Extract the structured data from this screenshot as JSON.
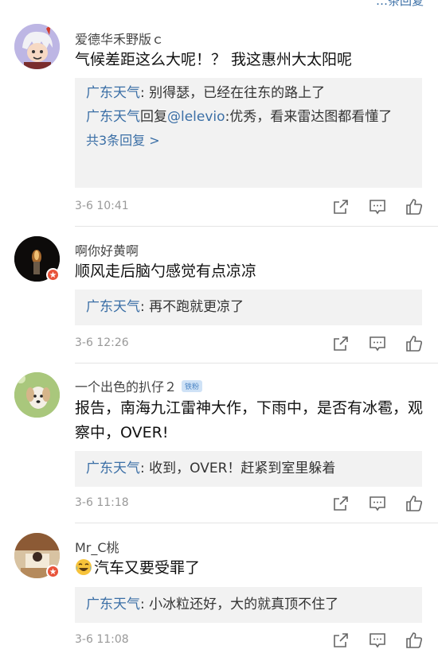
{
  "top_link": "…条回复",
  "comments": [
    {
      "user": "爱德华禾野版ｃ",
      "text": "气候差距这么大呢！？ 我这惠州大太阳呢",
      "replies": [
        {
          "name": "广东天气",
          "mid": "",
          "mention": "",
          "text": ": 别得瑟，已经在往东的路上了"
        },
        {
          "name": "广东天气",
          "mid": "回复",
          "mention": "@lelevio",
          "text": ":优秀，看来雷达图都看懂了"
        }
      ],
      "more": "共3条回复 >",
      "time": "3-6 10:41"
    },
    {
      "user": "啊你好黄啊",
      "text": "顺风走后脑勺感觉有点凉凉",
      "replies": [
        {
          "name": "广东天气",
          "text": ": 再不跑就更凉了"
        }
      ],
      "time": "3-6 12:26"
    },
    {
      "user": "一个出色的扒仔２",
      "fan_badge": "铁粉",
      "text": "报告，南海九江雷神大作，下雨中，是否有冰雹，观察中，OVER!",
      "replies": [
        {
          "name": "广东天气",
          "text": ": 收到，OVER！赶紧到室里躲着"
        }
      ],
      "time": "3-6 11:18"
    },
    {
      "user": "Mr_C桃",
      "text": "汽车又要受罪了",
      "replies": [
        {
          "name": "广东天气",
          "text": ": 小冰粒还好，大的就真顶不住了"
        }
      ],
      "time": "3-6 11:08"
    }
  ],
  "colors": {
    "link": "#3b6fa6",
    "badge": "#e8533a",
    "reply_bg": "#f2f2f2"
  }
}
